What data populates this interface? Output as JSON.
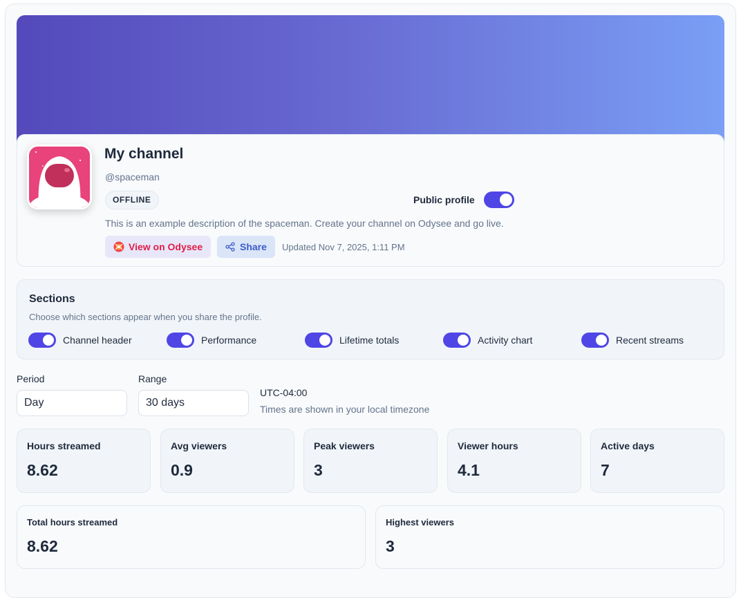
{
  "channel": {
    "name": "My channel",
    "handle": "@spaceman",
    "status": "OFFLINE",
    "public_profile_label": "Public profile",
    "public_profile_enabled": true,
    "description": "This is an example description of the spaceman. Create your channel on Odysee and go live.",
    "view_button": "View on Odysee",
    "share_button": "Share",
    "updated": "Updated Nov 7, 2025, 1:11 PM"
  },
  "sections": {
    "title": "Sections",
    "description": "Choose which sections appear when you share the profile.",
    "items": [
      {
        "label": "Channel header",
        "enabled": true
      },
      {
        "label": "Performance",
        "enabled": true
      },
      {
        "label": "Lifetime totals",
        "enabled": true
      },
      {
        "label": "Activity chart",
        "enabled": true
      },
      {
        "label": "Recent streams",
        "enabled": true
      }
    ]
  },
  "filters": {
    "period_label": "Period",
    "period_value": "Day",
    "range_label": "Range",
    "range_value": "30 days",
    "timezone": "UTC-04:00",
    "timezone_note": "Times are shown in your local timezone"
  },
  "stats": [
    {
      "label": "Hours streamed",
      "value": "8.62"
    },
    {
      "label": "Avg viewers",
      "value": "0.9"
    },
    {
      "label": "Peak viewers",
      "value": "3"
    },
    {
      "label": "Viewer hours",
      "value": "4.1"
    },
    {
      "label": "Active days",
      "value": "7"
    }
  ],
  "totals": [
    {
      "label": "Total hours streamed",
      "value": "8.62"
    },
    {
      "label": "Highest viewers",
      "value": "3"
    }
  ],
  "colors": {
    "accent": "#4f46e5",
    "banner_start": "#5349bb",
    "banner_end": "#7a9ff5",
    "odysee": "#e11d48",
    "avatar_bg": "#e8437a"
  }
}
